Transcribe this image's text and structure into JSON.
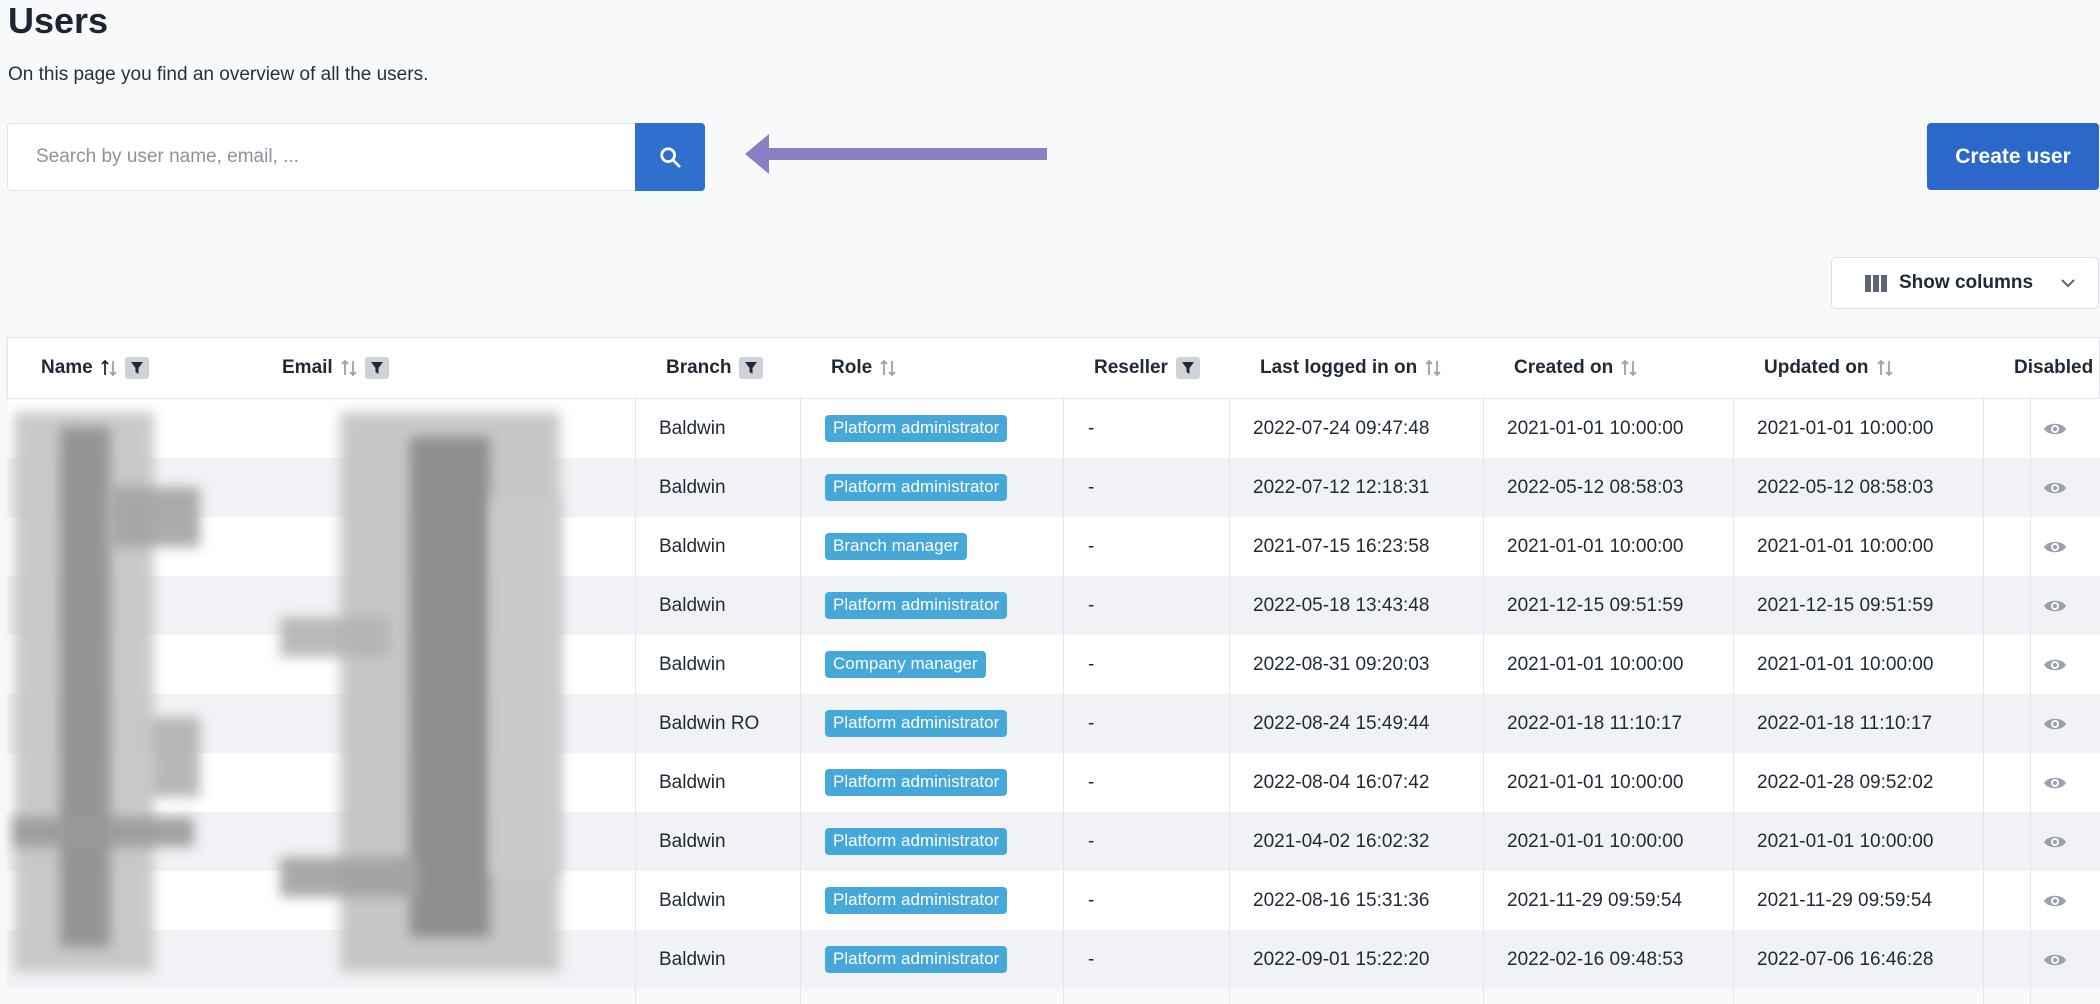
{
  "header": {
    "title": "Users",
    "subtitle": "On this page you find an overview of all the users."
  },
  "search": {
    "placeholder": "Search by user name, email, ...",
    "value": ""
  },
  "actions": {
    "create_user_label": "Create user",
    "show_columns_label": "Show columns"
  },
  "colors": {
    "primary": "#2b68c9",
    "badge": "#45a8d8",
    "annotation_arrow": "#8b80c4"
  },
  "table": {
    "columns": [
      {
        "key": "name",
        "label": "Name",
        "sortable": true,
        "filterable": true
      },
      {
        "key": "email",
        "label": "Email",
        "sortable": true,
        "filterable": true
      },
      {
        "key": "branch",
        "label": "Branch",
        "sortable": false,
        "filterable": true
      },
      {
        "key": "role",
        "label": "Role",
        "sortable": true,
        "filterable": false
      },
      {
        "key": "reseller",
        "label": "Reseller",
        "sortable": false,
        "filterable": true
      },
      {
        "key": "last_logged_in",
        "label": "Last logged in on",
        "sortable": true,
        "filterable": false
      },
      {
        "key": "created_on",
        "label": "Created on",
        "sortable": true,
        "filterable": false
      },
      {
        "key": "updated_on",
        "label": "Updated on",
        "sortable": true,
        "filterable": false
      },
      {
        "key": "disabled",
        "label": "Disabled",
        "sortable": false,
        "filterable": false
      }
    ],
    "rows": [
      {
        "branch": "Baldwin",
        "role": "Platform administrator",
        "reseller": "-",
        "last_logged_in": "2022-07-24 09:47:48",
        "created_on": "2021-01-01 10:00:00",
        "updated_on": "2021-01-01 10:00:00",
        "disabled_icon": "eye-icon"
      },
      {
        "branch": "Baldwin",
        "role": "Platform administrator",
        "reseller": "-",
        "last_logged_in": "2022-07-12 12:18:31",
        "created_on": "2022-05-12 08:58:03",
        "updated_on": "2022-05-12 08:58:03",
        "disabled_icon": "eye-icon"
      },
      {
        "branch": "Baldwin",
        "role": "Branch manager",
        "reseller": "-",
        "last_logged_in": "2021-07-15 16:23:58",
        "created_on": "2021-01-01 10:00:00",
        "updated_on": "2021-01-01 10:00:00",
        "disabled_icon": "eye-icon"
      },
      {
        "branch": "Baldwin",
        "role": "Platform administrator",
        "reseller": "-",
        "last_logged_in": "2022-05-18 13:43:48",
        "created_on": "2021-12-15 09:51:59",
        "updated_on": "2021-12-15 09:51:59",
        "disabled_icon": "eye-icon"
      },
      {
        "branch": "Baldwin",
        "role": "Company manager",
        "reseller": "-",
        "last_logged_in": "2022-08-31 09:20:03",
        "created_on": "2021-01-01 10:00:00",
        "updated_on": "2021-01-01 10:00:00",
        "disabled_icon": "eye-icon"
      },
      {
        "branch": "Baldwin RO",
        "role": "Platform administrator",
        "reseller": "-",
        "last_logged_in": "2022-08-24 15:49:44",
        "created_on": "2022-01-18 11:10:17",
        "updated_on": "2022-01-18 11:10:17",
        "disabled_icon": "eye-icon"
      },
      {
        "branch": "Baldwin",
        "role": "Platform administrator",
        "reseller": "-",
        "last_logged_in": "2022-08-04 16:07:42",
        "created_on": "2021-01-01 10:00:00",
        "updated_on": "2022-01-28 09:52:02",
        "disabled_icon": "eye-icon"
      },
      {
        "branch": "Baldwin",
        "role": "Platform administrator",
        "reseller": "-",
        "last_logged_in": "2021-04-02 16:02:32",
        "created_on": "2021-01-01 10:00:00",
        "updated_on": "2021-01-01 10:00:00",
        "disabled_icon": "eye-icon"
      },
      {
        "branch": "Baldwin",
        "role": "Platform administrator",
        "reseller": "-",
        "last_logged_in": "2022-08-16 15:31:36",
        "created_on": "2021-11-29 09:59:54",
        "updated_on": "2021-11-29 09:59:54",
        "disabled_icon": "eye-icon"
      },
      {
        "branch": "Baldwin",
        "role": "Platform administrator",
        "reseller": "-",
        "last_logged_in": "2022-09-01 15:22:20",
        "created_on": "2022-02-16 09:48:53",
        "updated_on": "2022-07-06 16:46:28",
        "disabled_icon": "eye-icon"
      }
    ]
  }
}
